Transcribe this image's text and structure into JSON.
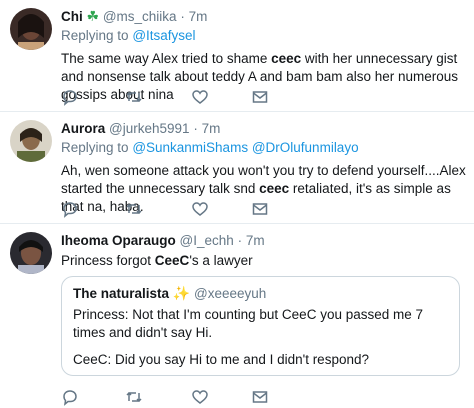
{
  "tweets": [
    {
      "name": "Chi",
      "name_emoji": "☘",
      "handle": "@ms_chiika",
      "sep": "·",
      "time": "7m",
      "replying_label": "Replying to",
      "mentions": [
        "@Itsafysel"
      ],
      "text_parts": [
        "The same way Alex tried to shame ",
        "ceec",
        " with her unnecessary gist and nonsense talk about teddy A and bam bam also her numerous gossips about nina"
      ]
    },
    {
      "name": "Aurora",
      "handle": "@jurkeh5991",
      "sep": "·",
      "time": "7m",
      "replying_label": "Replying to",
      "mentions": [
        "@SunkanmiShams",
        "@DrOlufunmilayo"
      ],
      "text_parts": [
        "Ah, wen someone attack you won't you try to defend yourself....Alex started the unnecessary talk snd ",
        "ceec",
        " retaliated, it's as simple as that na, haba."
      ]
    },
    {
      "name": "Iheoma Oparaugo",
      "handle": "@I_echh",
      "sep": "·",
      "time": "7m",
      "text_parts": [
        "Princess forgot ",
        "CeeC",
        "'s a lawyer"
      ],
      "quote": {
        "name": "The naturalista",
        "name_emoji": "✨",
        "handle": "@xeeeeyuh",
        "line1": "Princess: Not that I'm counting but CeeC you passed me 7 times and didn't say Hi.",
        "line2": "CeeC: Did you say Hi to me and I didn't respond?"
      }
    }
  ],
  "icons": {
    "reply": "reply-icon",
    "retweet": "retweet-icon",
    "like": "heart-icon",
    "dm": "envelope-icon"
  },
  "colors": {
    "link": "#1b95e0",
    "meta": "#657786",
    "text": "#14171a",
    "divider": "#e6ecf0",
    "icon": "#657786"
  }
}
